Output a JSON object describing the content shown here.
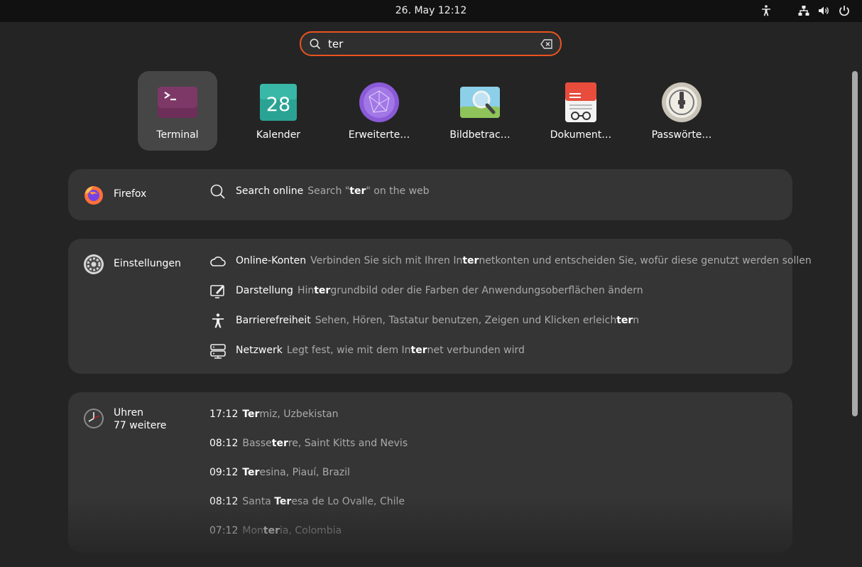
{
  "topbar": {
    "clock": "26. May  12:12"
  },
  "search": {
    "value": "ter"
  },
  "apps": [
    {
      "label": "Terminal",
      "icon": "terminal-icon"
    },
    {
      "label": "Kalender",
      "icon": "calendar-icon",
      "day": "28"
    },
    {
      "label": "Erweiterte…",
      "icon": "extensions-icon"
    },
    {
      "label": "Bildbetrac…",
      "icon": "image-viewer-icon"
    },
    {
      "label": "Dokument…",
      "icon": "document-viewer-icon"
    },
    {
      "label": "Passwörte…",
      "icon": "passwords-icon"
    }
  ],
  "firefox": {
    "provider": "Firefox",
    "result": {
      "title": "Search online",
      "desc_pre": "Search \"",
      "desc_bold": "ter",
      "desc_post": "\" on the web"
    }
  },
  "settings": {
    "provider": "Einstellungen",
    "results": [
      {
        "title": "Online-Konten",
        "pre": "Verbinden Sie sich mit Ihren In",
        "bold": "ter",
        "post": "netkonten und entscheiden Sie, wofür diese genutzt werden sollen"
      },
      {
        "title": "Darstellung",
        "pre": "Hin",
        "bold": "ter",
        "post": "grundbild oder die Farben der Anwendungsoberflächen ändern"
      },
      {
        "title": "Barrierefreiheit",
        "pre": "Sehen, Hören, Tastatur benutzen, Zeigen und Klicken erleich",
        "bold": "ter",
        "post": "n"
      },
      {
        "title": "Netzwerk",
        "pre": "Legt fest, wie mit dem In",
        "bold": "ter",
        "post": "net verbunden wird"
      }
    ]
  },
  "clocks": {
    "provider": "Uhren",
    "more": "77 weitere",
    "results": [
      {
        "time": "17:12",
        "pre": "",
        "bold": "Ter",
        "post": "miz, Uzbekistan"
      },
      {
        "time": "08:12",
        "pre": "Basse",
        "bold": "ter",
        "post": "re, Saint Kitts and Nevis"
      },
      {
        "time": "09:12",
        "pre": "",
        "bold": "Ter",
        "post": "esina, Piauí, Brazil"
      },
      {
        "time": "08:12",
        "pre": "Santa ",
        "bold": "Ter",
        "post": "esa de Lo Ovalle, Chile"
      },
      {
        "time": "07:12",
        "pre": "Mon",
        "bold": "ter",
        "post": "ia, Colombia"
      }
    ]
  },
  "colors": {
    "accent": "#e9541f",
    "card": "#353535",
    "background": "#242424",
    "terminal": "#6e2e5a"
  }
}
